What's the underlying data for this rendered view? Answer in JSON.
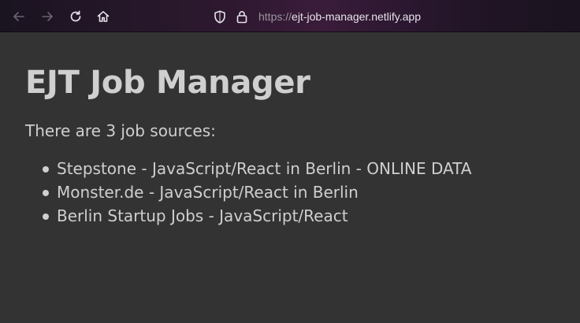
{
  "browser": {
    "url_scheme": "https://",
    "url_host": "ejt-job-manager.netlify.app",
    "icons": {
      "back": "back-arrow-icon",
      "forward": "forward-arrow-icon",
      "reload": "reload-icon",
      "home": "home-icon",
      "shield": "tracking-protection-shield-icon",
      "lock": "lock-icon"
    }
  },
  "page": {
    "title": "EJT Job Manager",
    "intro": "There are 3 job sources:",
    "sources": [
      {
        "label": "Stepstone - JavaScript/React in Berlin - ONLINE DATA"
      },
      {
        "label": "Monster.de - JavaScript/React in Berlin"
      },
      {
        "label": "Berlin Startup Jobs - JavaScript/React"
      }
    ]
  },
  "colors": {
    "page_background": "#333333",
    "text": "#cfcfcf"
  }
}
